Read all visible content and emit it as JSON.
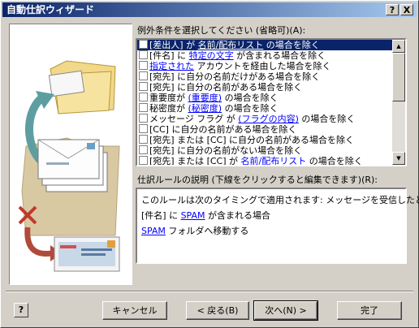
{
  "window": {
    "title": "自動仕訳ウィザード",
    "help_btn": "?",
    "close_btn": "X"
  },
  "conditions": {
    "label": "例外条件を選択してください (省略可)(A):",
    "rows": [
      {
        "checked": false,
        "selected": true,
        "parts": [
          {
            "t": "[差出人] が "
          },
          {
            "t": "名前/配布リスト",
            "u": true
          },
          {
            "t": " の場合を除く"
          }
        ]
      },
      {
        "checked": false,
        "parts": [
          {
            "t": "[件名] に "
          },
          {
            "t": "特定の文字",
            "u": true
          },
          {
            "t": " が含まれる場合を除く"
          }
        ]
      },
      {
        "checked": false,
        "parts": [
          {
            "t": "指定された",
            "u": true
          },
          {
            "t": " アカウントを経由した場合を除く"
          }
        ]
      },
      {
        "checked": false,
        "parts": [
          {
            "t": "[宛先] に自分の名前だけがある場合を除く"
          }
        ]
      },
      {
        "checked": false,
        "parts": [
          {
            "t": "[宛先] に自分の名前がある場合を除く"
          }
        ]
      },
      {
        "checked": false,
        "parts": [
          {
            "t": "重要度が "
          },
          {
            "t": "(重要度)",
            "u": true
          },
          {
            "t": " の場合を除く"
          }
        ]
      },
      {
        "checked": false,
        "parts": [
          {
            "t": "秘密度が "
          },
          {
            "t": "(秘密度)",
            "u": true
          },
          {
            "t": " の場合を除く"
          }
        ]
      },
      {
        "checked": false,
        "parts": [
          {
            "t": "メッセージ フラグ が "
          },
          {
            "t": "(フラグの内容)",
            "u": true
          },
          {
            "t": " の場合を除く"
          }
        ]
      },
      {
        "checked": false,
        "parts": [
          {
            "t": "[CC] に自分の名前がある場合を除く"
          }
        ]
      },
      {
        "checked": false,
        "parts": [
          {
            "t": "[宛先] または [CC] に自分の名前がある場合を除く"
          }
        ]
      },
      {
        "checked": false,
        "parts": [
          {
            "t": "[宛先] に自分の名前がない場合を除く"
          }
        ]
      },
      {
        "checked": false,
        "parts": [
          {
            "t": "[宛先] または [CC] が "
          },
          {
            "t": "名前/配布リスト",
            "u": true
          },
          {
            "t": " の場合を除く"
          }
        ]
      }
    ]
  },
  "description": {
    "label": "仕訳ルールの説明 (下線をクリックすると編集できます)(R):",
    "lines": [
      [
        {
          "t": "このルールは次のタイミングで適用されます: メッセージを受信したとき"
        }
      ],
      [
        {
          "t": "[件名] に "
        },
        {
          "t": "SPAM",
          "u": true
        },
        {
          "t": " が含まれる場合"
        }
      ],
      [
        {
          "t": "SPAM",
          "u": true
        },
        {
          "t": " フォルダへ移動する"
        }
      ]
    ]
  },
  "buttons": {
    "cancel": "キャンセル",
    "back": "< 戻る(B)",
    "next": "次へ(N) >",
    "finish": "完了",
    "help": "?"
  },
  "colors": {
    "selection": "#0a246a",
    "link": "#0000ff",
    "face": "#d4d0c8"
  }
}
